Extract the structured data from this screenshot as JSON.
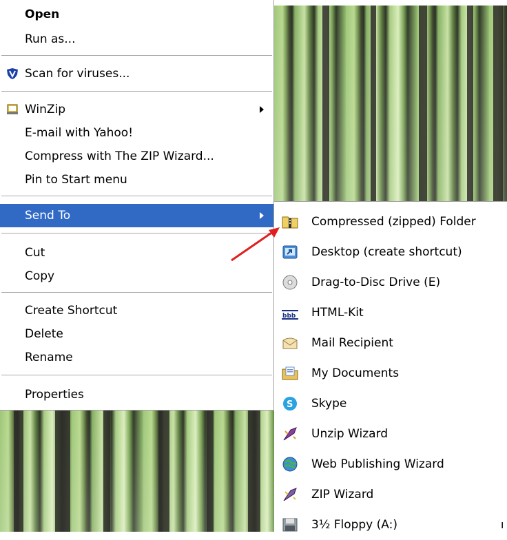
{
  "context_menu": {
    "items": [
      {
        "label": "Open",
        "bold": true
      },
      {
        "label": "Run as..."
      },
      {
        "label": "Scan for viruses...",
        "icon": "shield-icon"
      },
      {
        "label": "WinZip",
        "icon": "winzip-icon",
        "submenu": true
      },
      {
        "label": "E-mail with Yahoo!"
      },
      {
        "label": "Compress with The ZIP Wizard..."
      },
      {
        "label": "Pin to Start menu"
      },
      {
        "label": "Send To",
        "submenu": true,
        "selected": true
      },
      {
        "label": "Cut"
      },
      {
        "label": "Copy"
      },
      {
        "label": "Create Shortcut"
      },
      {
        "label": "Delete"
      },
      {
        "label": "Rename"
      },
      {
        "label": "Properties"
      }
    ]
  },
  "send_to_menu": {
    "items": [
      {
        "label": "Compressed (zipped) Folder",
        "icon": "zip-folder-icon"
      },
      {
        "label": "Desktop (create shortcut)",
        "icon": "desktop-shortcut-icon"
      },
      {
        "label": "Drag-to-Disc Drive (E)",
        "icon": "cd-drive-icon"
      },
      {
        "label": "HTML-Kit",
        "icon": "htmlkit-icon"
      },
      {
        "label": "Mail Recipient",
        "icon": "mail-icon"
      },
      {
        "label": "My Documents",
        "icon": "my-documents-icon"
      },
      {
        "label": "Skype",
        "icon": "skype-icon"
      },
      {
        "label": "Unzip Wizard",
        "icon": "unzip-wizard-icon"
      },
      {
        "label": "Web Publishing Wizard",
        "icon": "web-publishing-icon"
      },
      {
        "label": "ZIP Wizard",
        "icon": "zip-wizard-icon"
      },
      {
        "label": "3½ Floppy (A:)",
        "icon": "floppy-icon"
      }
    ]
  },
  "colors": {
    "selection": "#316ac5",
    "annotation_arrow": "#e02020"
  },
  "trailing_glyph": "ו"
}
